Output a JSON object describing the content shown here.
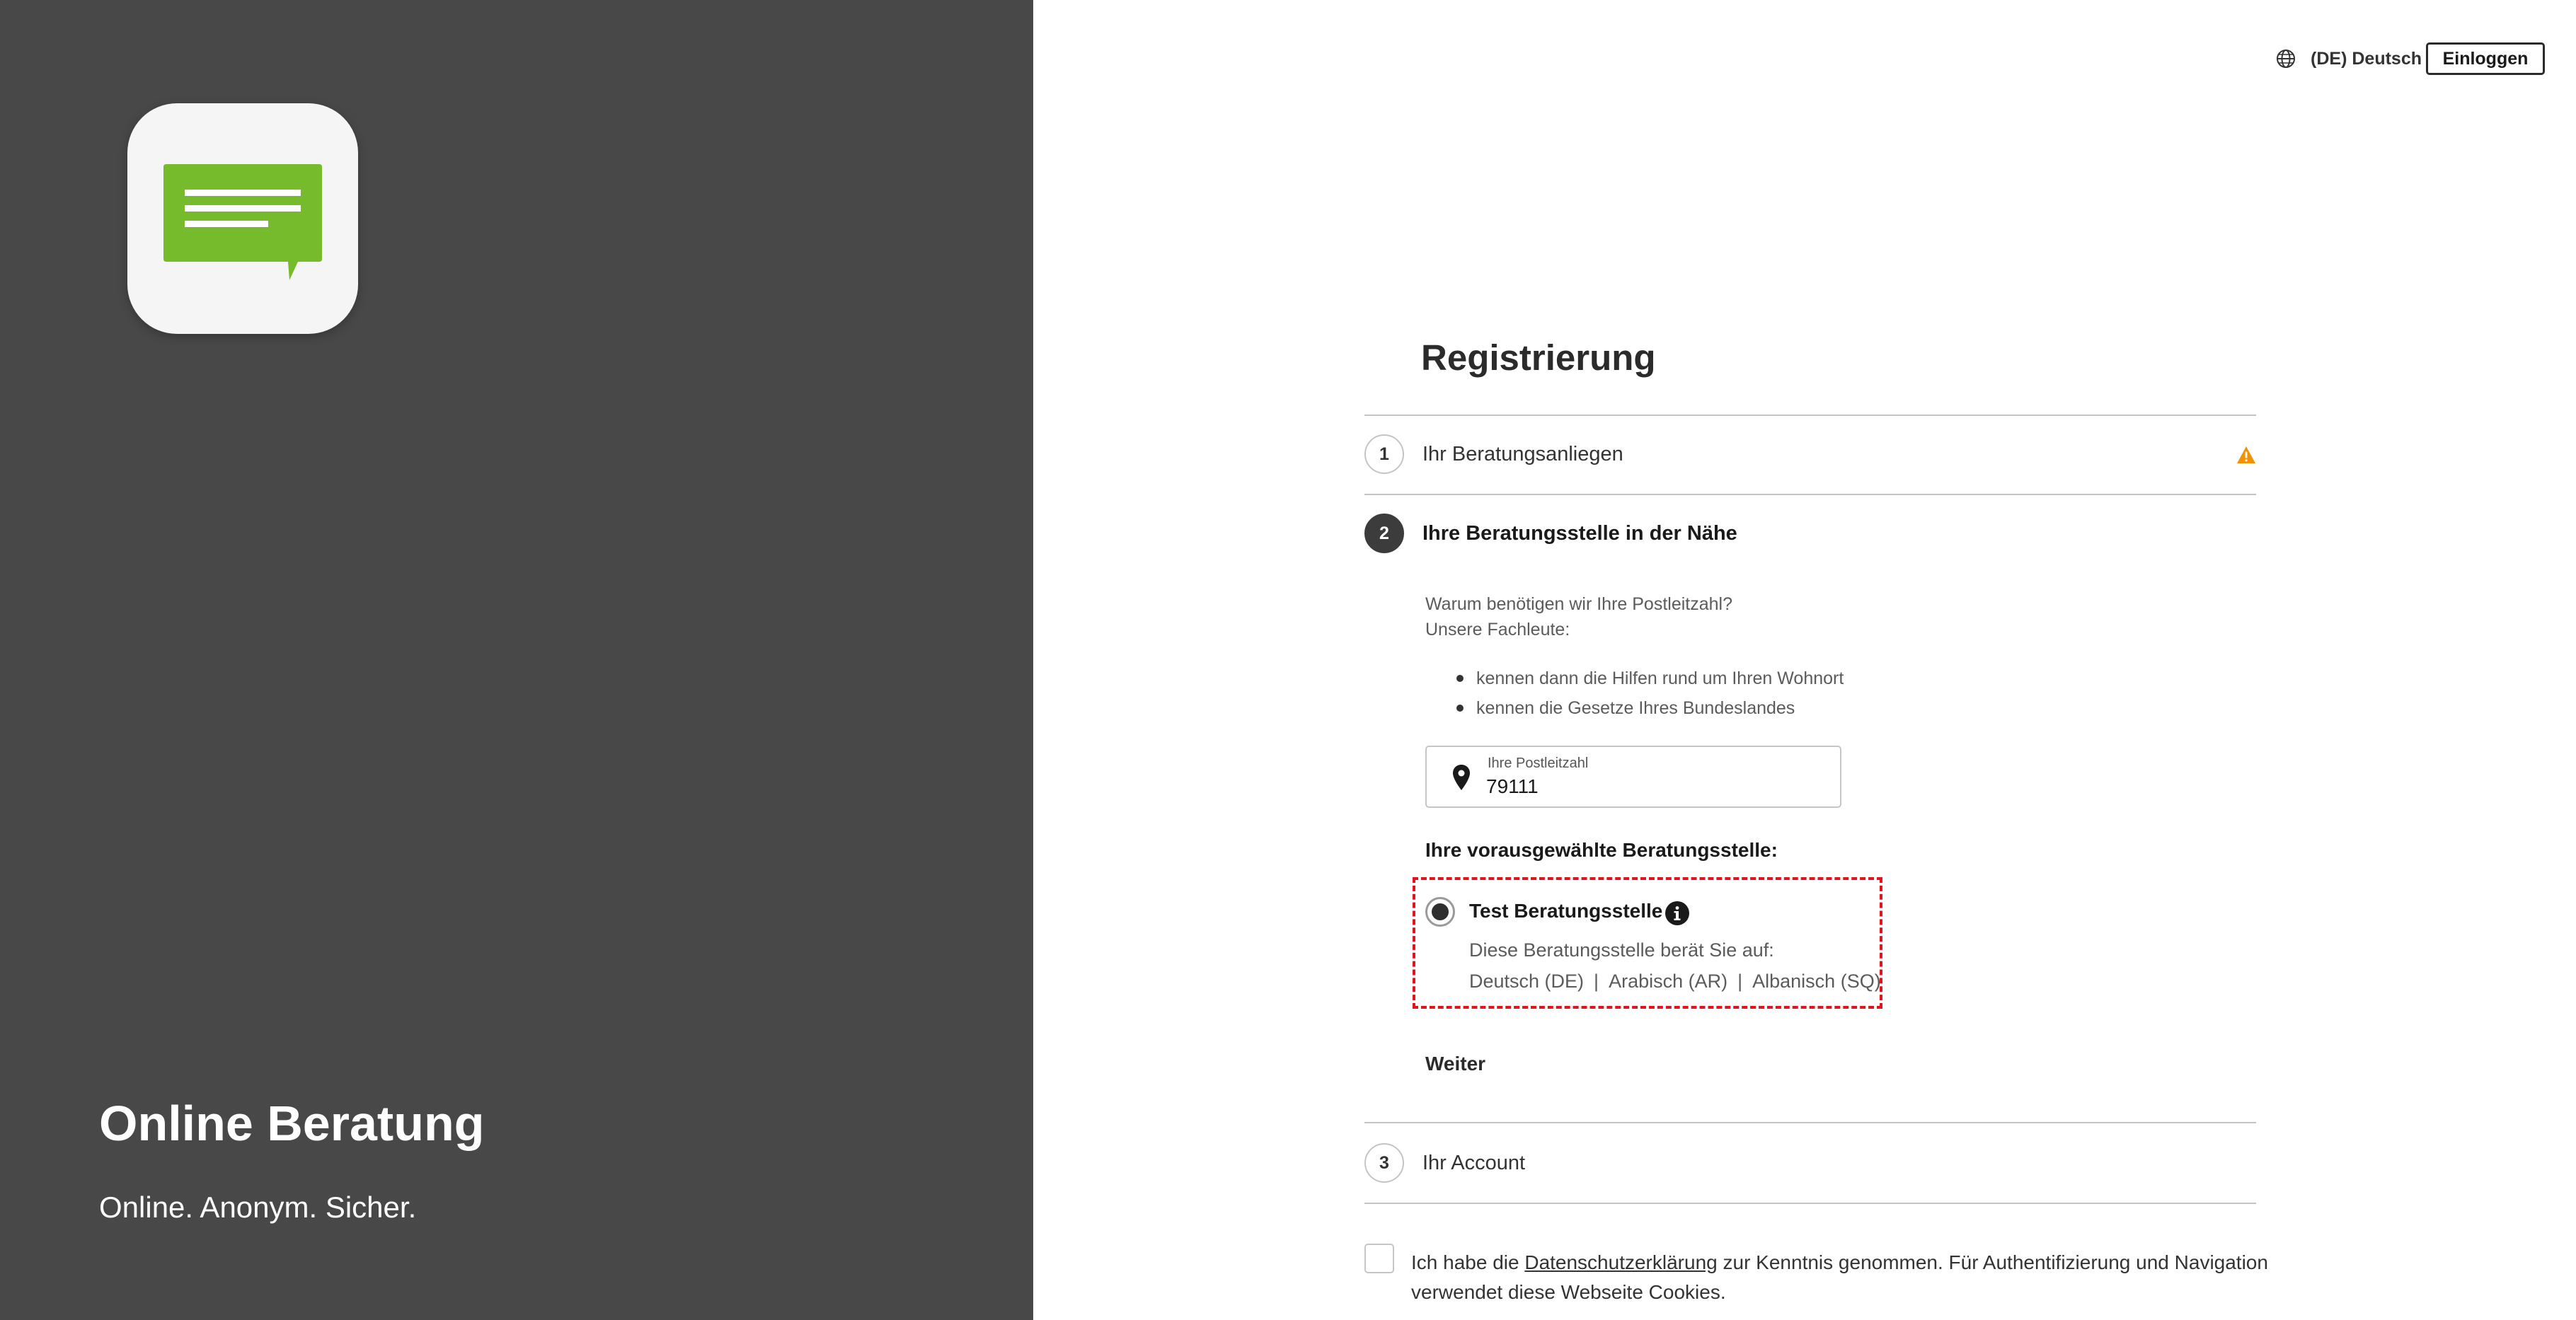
{
  "brand": {
    "title": "Online Beratung",
    "tagline": "Online. Anonym. Sicher.",
    "logo_icon": "chat-bubble-icon",
    "logo_color": "#76bb2b"
  },
  "header": {
    "language_label": "(DE) Deutsch",
    "login_label": "Einloggen",
    "globe_icon": "globe-icon"
  },
  "registration": {
    "title": "Registrierung",
    "steps": [
      {
        "number": "1",
        "label": "Ihr Beratungsanliegen",
        "status_icon": "warning-icon",
        "status_color": "#f39200"
      },
      {
        "number": "2",
        "label": "Ihre Beratungsstelle in der Nähe",
        "active": true
      },
      {
        "number": "3",
        "label": "Ihr Account"
      }
    ],
    "why_postcode": "Warum benötigen wir Ihre Postleitzahl?",
    "experts_intro": "Unsere Fachleute:",
    "reasons": [
      "kennen dann die Hilfen rund um Ihren Wohnort",
      "kennen die Gesetze Ihres Bundeslandes"
    ],
    "postcode": {
      "label": "Ihre Postleitzahl",
      "value": "79111",
      "icon": "location-pin-icon"
    },
    "preselected_heading": "Ihre vorausgewählte Beratungsstelle:",
    "agency": {
      "name": "Test Beratungsstelle",
      "selected": true,
      "advises_label": "Diese Beratungsstelle berät Sie auf:",
      "languages": [
        "Deutsch (DE)",
        "Arabisch (AR)",
        "Albanisch (SQ)"
      ],
      "separator": "|",
      "highlight_color": "#e3131c"
    },
    "next_label": "Weiter",
    "privacy": {
      "before": "Ich habe die ",
      "link": "Datenschutzerklärung",
      "after": " zur Kenntnis genommen. Für Authentifizierung und Navigation verwendet diese Webseite Cookies.",
      "checked": false
    }
  }
}
